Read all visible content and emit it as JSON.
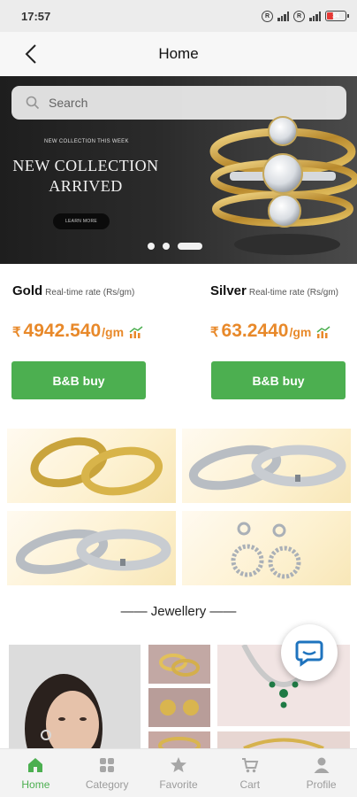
{
  "status_bar": {
    "time": "17:57",
    "battery": "34"
  },
  "header": {
    "title": "Home"
  },
  "search": {
    "placeholder": "Search"
  },
  "banner": {
    "kicker": "NEW COLLECTION THIS WEEK",
    "headline": "NEW COLLECTION ARRIVED",
    "cta": "LEARN MORE",
    "active_slide": 3,
    "slide_count": 3
  },
  "rates": {
    "gold": {
      "name": "Gold",
      "subtitle": "Real-time rate (Rs/gm)",
      "currency": "₹",
      "value": "4942.540",
      "unit": "/gm",
      "buy_label": "B&B buy"
    },
    "silver": {
      "name": "Silver",
      "subtitle": "Real-time rate (Rs/gm)",
      "currency": "₹",
      "value": "63.2440",
      "unit": "/gm",
      "buy_label": "B&B buy"
    }
  },
  "section": {
    "title": "—— Jewellery ——"
  },
  "nav": {
    "items": [
      {
        "label": "Home",
        "icon": "home-icon",
        "active": true
      },
      {
        "label": "Category",
        "icon": "category-icon",
        "active": false
      },
      {
        "label": "Favorite",
        "icon": "star-icon",
        "active": false
      },
      {
        "label": "Cart",
        "icon": "cart-icon",
        "active": false
      },
      {
        "label": "Profile",
        "icon": "profile-icon",
        "active": false
      }
    ]
  },
  "colors": {
    "accent_green": "#4caf50",
    "price_orange": "#e8892a",
    "gold": "#c9a43c",
    "silver": "#bfc3c8"
  }
}
